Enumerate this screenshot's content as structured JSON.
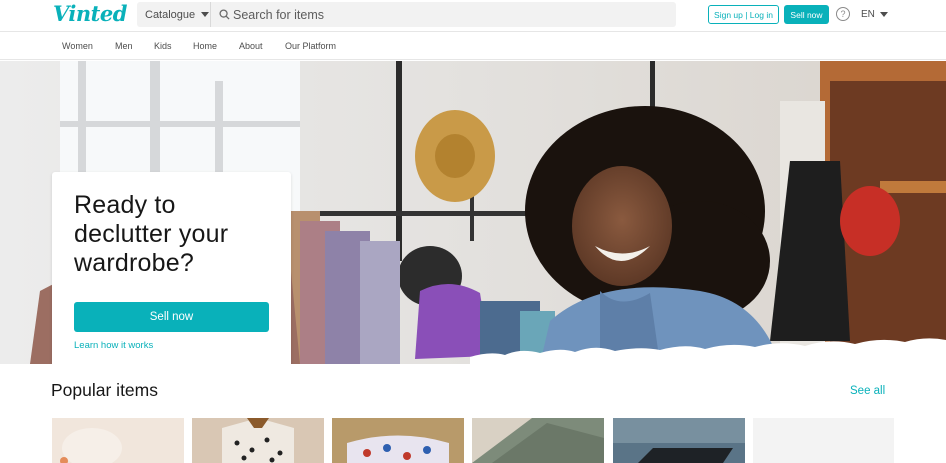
{
  "header": {
    "logo": "Vinted",
    "catalogue_label": "Catalogue",
    "search_placeholder": "Search for items",
    "signup_label": "Sign up | Log in",
    "sell_label": "Sell now",
    "help_glyph": "?",
    "language": "EN"
  },
  "nav": {
    "items": [
      "Women",
      "Men",
      "Kids",
      "Home",
      "About",
      "Our Platform"
    ]
  },
  "hero": {
    "title": "Ready to declutter your wardrobe?",
    "sell_button": "Sell now",
    "learn_link": "Learn how it works"
  },
  "popular": {
    "title": "Popular items",
    "see_all": "See all",
    "item_icons": [
      "clothing-photo",
      "dotted-blouse-on-hanger-photo",
      "floral-garment-photo",
      "knit-fabric-photo",
      "laptop-photo",
      "empty-photo"
    ]
  },
  "colors": {
    "accent": "#09b1ba",
    "text": "#171717",
    "muted": "#4d4d4d",
    "search_bg": "#f2f2f2"
  }
}
